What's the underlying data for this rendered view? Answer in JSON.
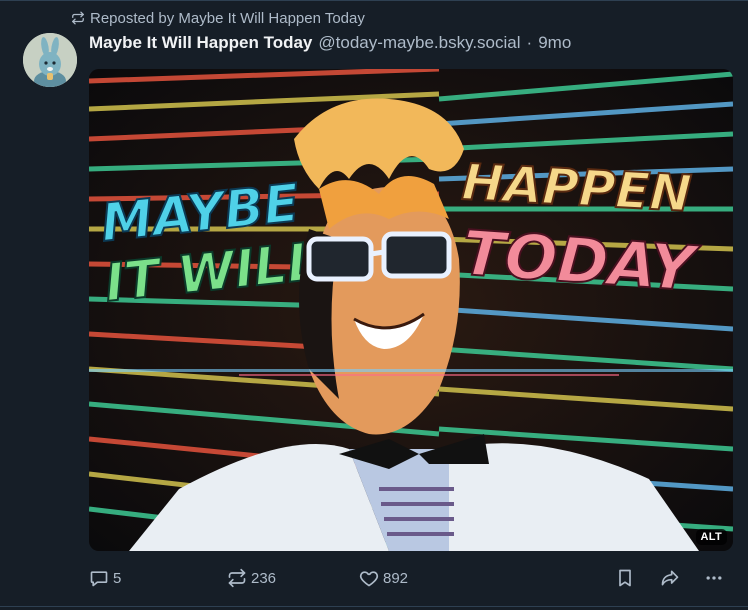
{
  "repost": {
    "label": "Reposted by Maybe It Will Happen Today"
  },
  "post": {
    "author_name": "Maybe It Will Happen Today",
    "handle": "@today-maybe.bsky.social",
    "separator": "·",
    "age": "9mo",
    "image": {
      "alt_badge": "ALT",
      "art_text": {
        "left": [
          "MAYBE",
          "IT WILL"
        ],
        "right": [
          "HAPPEN",
          "TODAY"
        ]
      }
    }
  },
  "actions": {
    "reply_count": "5",
    "repost_count": "236",
    "like_count": "892"
  },
  "icons": {
    "repost": "repost-icon",
    "reply": "reply-icon",
    "like": "heart-icon",
    "bookmark": "bookmark-icon",
    "share": "share-icon",
    "more": "more-icon"
  },
  "colors": {
    "background": "#161e27",
    "text": "#f1f3f5",
    "muted": "#aebbc9",
    "divider": "#2e4052"
  }
}
